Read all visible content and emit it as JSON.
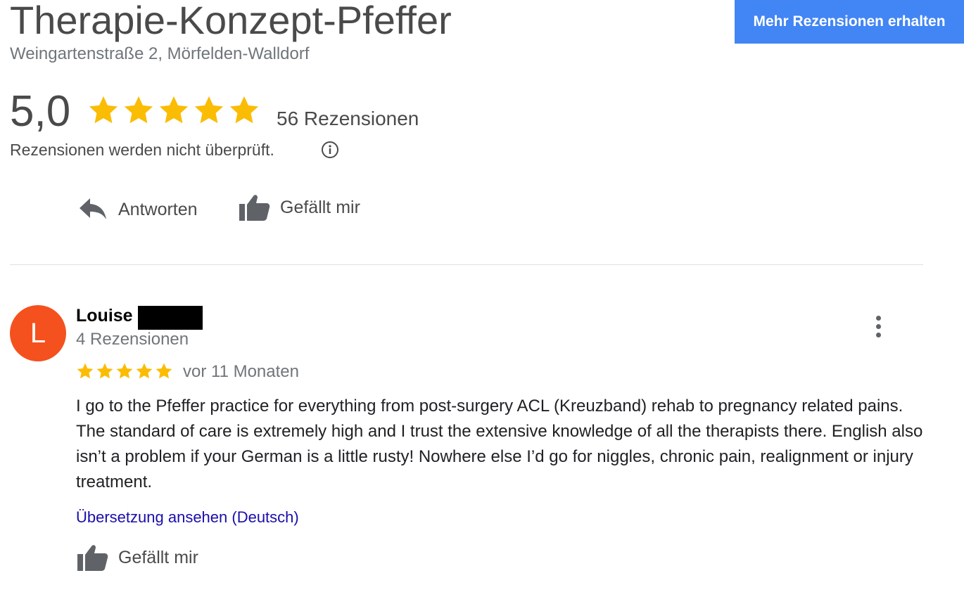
{
  "business": {
    "name": "Therapie-Konzept-Pfeffer",
    "address": "Weingartenstraße 2, Mörfelden-Walldorf"
  },
  "cta": {
    "label": "Mehr Rezensionen erhalten",
    "color": "#4285f4"
  },
  "rating": {
    "value": "5,0",
    "stars": 5,
    "count_label": "56 Rezensionen",
    "disclaimer": "Rezensionen werden nicht überprüft.",
    "star_color": "#fbbc04",
    "info_icon": "info-icon"
  },
  "owner_actions": {
    "reply_label": "Antworten",
    "reply_icon": "reply-arrow-icon",
    "like_label": "Gefällt mir",
    "like_icon": "thumbs-up-icon"
  },
  "review": {
    "avatar_letter": "L",
    "avatar_color": "#f4511e",
    "reviewer_name": "Louise",
    "reviewer_meta": "4 Rezensionen",
    "stars": 5,
    "date": "vor 11 Monaten",
    "text": "I go to the Pfeffer practice for everything from post-surgery ACL (Kreuzband) rehab to pregnancy related pains. The standard of care is extremely high and I trust the extensive knowledge of all the therapists there. English also isn’t a problem if your German is a little rusty! Nowhere else I’d go for niggles, chronic pain, realignment or injury treatment.",
    "translate_label": "Übersetzung ansehen (Deutsch)",
    "like_label": "Gefällt mir",
    "menu_icon": "more-vert-icon"
  }
}
